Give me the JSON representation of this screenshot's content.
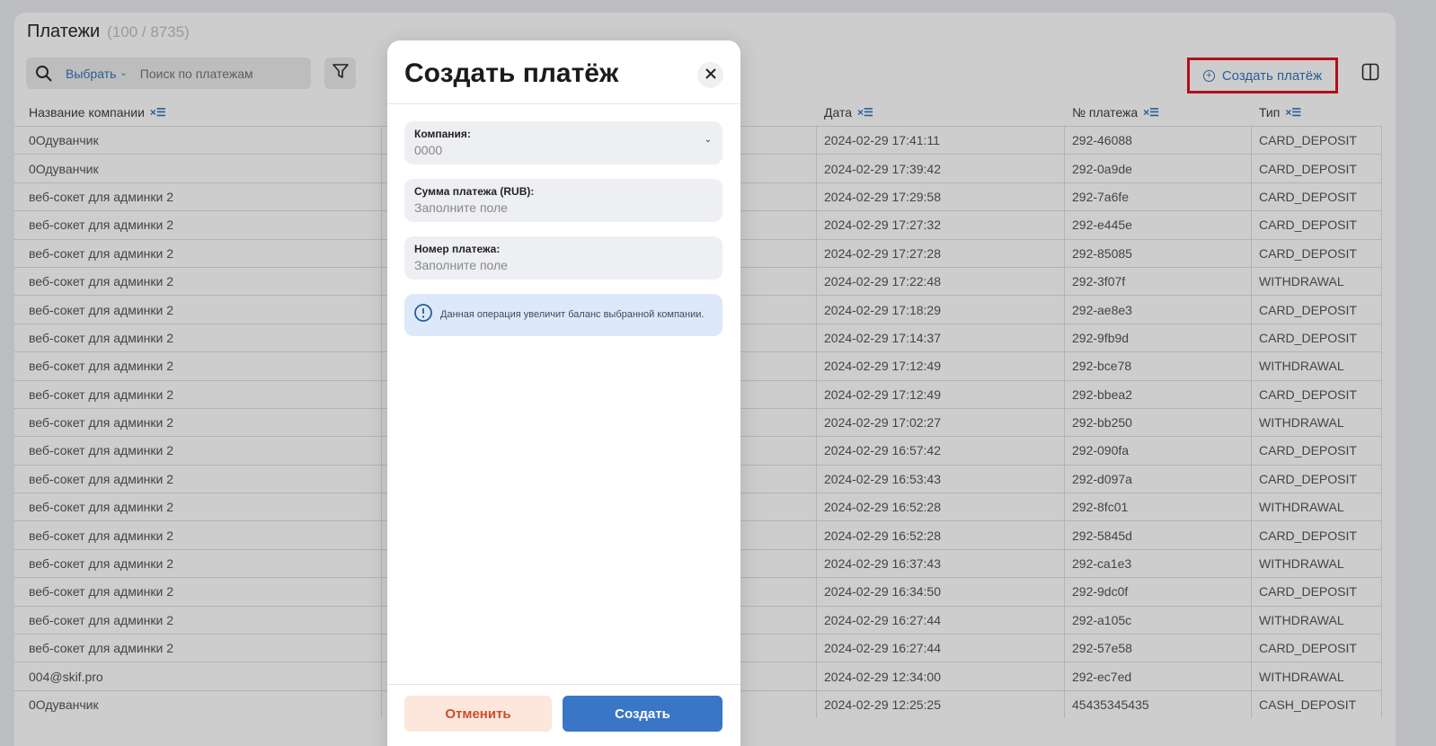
{
  "page": {
    "title": "Платежи",
    "count": "(100 / 8735)"
  },
  "search": {
    "select_label": "Выбрать",
    "placeholder": "Поиск по платежам"
  },
  "toolbar": {
    "create_label": "Создать платёж"
  },
  "table": {
    "columns": {
      "company": "Название компании",
      "date": "Дата",
      "number": "№ платежа",
      "type": "Тип"
    },
    "rows": [
      {
        "company": "0Одуванчик",
        "date": "2024-02-29 17:41:11",
        "number": "292-46088",
        "type": "CARD_DEPOSIT"
      },
      {
        "company": "0Одуванчик",
        "date": "2024-02-29 17:39:42",
        "number": "292-0a9de",
        "type": "CARD_DEPOSIT"
      },
      {
        "company": "веб-сокет для админки 2",
        "date": "2024-02-29 17:29:58",
        "number": "292-7a6fe",
        "type": "CARD_DEPOSIT"
      },
      {
        "company": "веб-сокет для админки 2",
        "date": "2024-02-29 17:27:32",
        "number": "292-e445e",
        "type": "CARD_DEPOSIT"
      },
      {
        "company": "веб-сокет для админки 2",
        "date": "2024-02-29 17:27:28",
        "number": "292-85085",
        "type": "CARD_DEPOSIT"
      },
      {
        "company": "веб-сокет для админки 2",
        "date": "2024-02-29 17:22:48",
        "number": "292-3f07f",
        "type": "WITHDRAWAL"
      },
      {
        "company": "веб-сокет для админки 2",
        "date": "2024-02-29 17:18:29",
        "number": "292-ae8e3",
        "type": "CARD_DEPOSIT"
      },
      {
        "company": "веб-сокет для админки 2",
        "date": "2024-02-29 17:14:37",
        "number": "292-9fb9d",
        "type": "CARD_DEPOSIT"
      },
      {
        "company": "веб-сокет для админки 2",
        "date": "2024-02-29 17:12:49",
        "number": "292-bce78",
        "type": "WITHDRAWAL"
      },
      {
        "company": "веб-сокет для админки 2",
        "date": "2024-02-29 17:12:49",
        "number": "292-bbea2",
        "type": "CARD_DEPOSIT"
      },
      {
        "company": "веб-сокет для админки 2",
        "date": "2024-02-29 17:02:27",
        "number": "292-bb250",
        "type": "WITHDRAWAL"
      },
      {
        "company": "веб-сокет для админки 2",
        "date": "2024-02-29 16:57:42",
        "number": "292-090fa",
        "type": "CARD_DEPOSIT"
      },
      {
        "company": "веб-сокет для админки 2",
        "date": "2024-02-29 16:53:43",
        "number": "292-d097a",
        "type": "CARD_DEPOSIT"
      },
      {
        "company": "веб-сокет для админки 2",
        "date": "2024-02-29 16:52:28",
        "number": "292-8fc01",
        "type": "WITHDRAWAL"
      },
      {
        "company": "веб-сокет для админки 2",
        "date": "2024-02-29 16:52:28",
        "number": "292-5845d",
        "type": "CARD_DEPOSIT"
      },
      {
        "company": "веб-сокет для админки 2",
        "date": "2024-02-29 16:37:43",
        "number": "292-ca1e3",
        "type": "WITHDRAWAL"
      },
      {
        "company": "веб-сокет для админки 2",
        "date": "2024-02-29 16:34:50",
        "number": "292-9dc0f",
        "type": "CARD_DEPOSIT"
      },
      {
        "company": "веб-сокет для админки 2",
        "date": "2024-02-29 16:27:44",
        "number": "292-a105c",
        "type": "WITHDRAWAL"
      },
      {
        "company": "веб-сокет для админки 2",
        "date": "2024-02-29 16:27:44",
        "number": "292-57e58",
        "type": "CARD_DEPOSIT"
      },
      {
        "company": "004@skif.pro",
        "date": "2024-02-29 12:34:00",
        "number": "292-ec7ed",
        "type": "WITHDRAWAL"
      },
      {
        "company": "0Одуванчик",
        "date": "2024-02-29 12:25:25",
        "number": "45435345435",
        "type": "CASH_DEPOSIT"
      }
    ]
  },
  "modal": {
    "title": "Создать платёж",
    "company_label": "Компания:",
    "company_value": "0000",
    "amount_label": "Сумма платежа (RUB):",
    "amount_placeholder": "Заполните поле",
    "number_label": "Номер платежа:",
    "number_placeholder": "Заполните поле",
    "info_text": "Данная операция увеличит баланс выбранной компании.",
    "cancel_label": "Отменить",
    "create_label": "Создать"
  },
  "colors": {
    "accent": "#3a76c6",
    "highlight_border": "#b0101b",
    "cancel_bg": "#fde6dc",
    "info_bg": "#dde9fa"
  }
}
